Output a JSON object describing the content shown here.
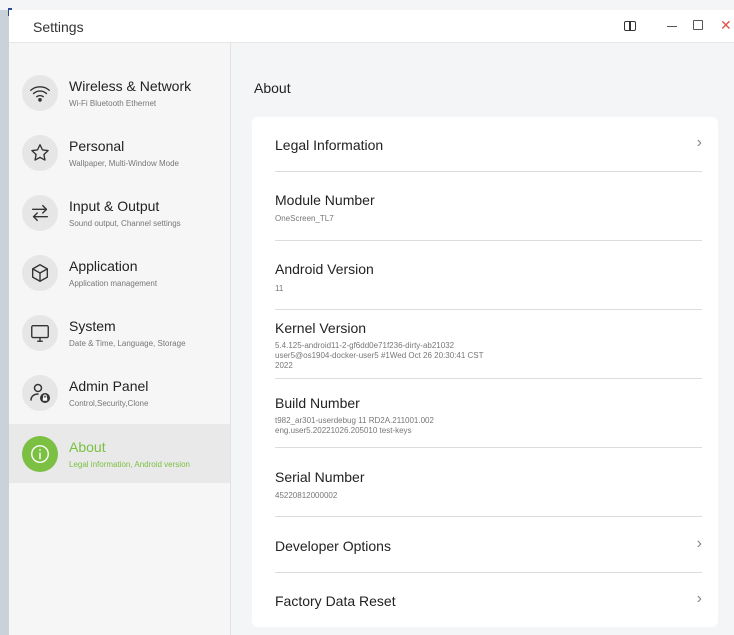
{
  "window": {
    "title": "Settings",
    "controls": [
      "split-screen-icon",
      "minimize-icon",
      "maximize-icon",
      "close-icon"
    ],
    "close_glyph": "✕"
  },
  "sidebar": {
    "items": [
      {
        "title": "Wireless & Network",
        "subtitle": "Wi-Fi Bluetooth Ethernet",
        "icon": "wifi-icon"
      },
      {
        "title": "Personal",
        "subtitle": "Wallpaper, Multi-Window Mode",
        "icon": "star-icon"
      },
      {
        "title": "Input & Output",
        "subtitle": "Sound output, Channel settings",
        "icon": "swap-arrows-icon"
      },
      {
        "title": "Application",
        "subtitle": "Application management",
        "icon": "cube-icon"
      },
      {
        "title": "System",
        "subtitle": "Date & Time, Language, Storage",
        "icon": "monitor-icon"
      },
      {
        "title": "Admin Panel",
        "subtitle": "Control,Security,Clone",
        "icon": "admin-user-lock-icon"
      },
      {
        "title": "About",
        "subtitle": "Legal information, Android version",
        "icon": "info-icon",
        "active": true
      }
    ]
  },
  "main": {
    "heading": "About",
    "rows": [
      {
        "title": "Legal Information",
        "chevron": true
      },
      {
        "title": "Module Number",
        "value": "OneScreen_TL7"
      },
      {
        "title": "Android Version",
        "value": "11"
      },
      {
        "title": "Kernel Version",
        "value_lines": [
          "5.4.125-android11-2-gf6dd0e71f236-dirty-ab21032",
          "user5@os1904-docker-user5 #1Wed Oct 26 20:30:41 CST",
          "2022"
        ]
      },
      {
        "title": "Build Number",
        "value_lines": [
          "t982_ar301-userdebug 11 RD2A.211001.002",
          "eng.user5.20221026.205010 test-keys"
        ]
      },
      {
        "title": "Serial Number",
        "value": "45220812000002"
      },
      {
        "title": "Developer Options",
        "chevron": true
      },
      {
        "title": "Factory Data Reset",
        "chevron": true
      }
    ],
    "chevron_glyph": "›"
  },
  "colors": {
    "accent": "#7bc043",
    "close": "#e0544b",
    "sidebar_bg": "#f6f6f6",
    "main_bg": "#f4f5f7"
  }
}
